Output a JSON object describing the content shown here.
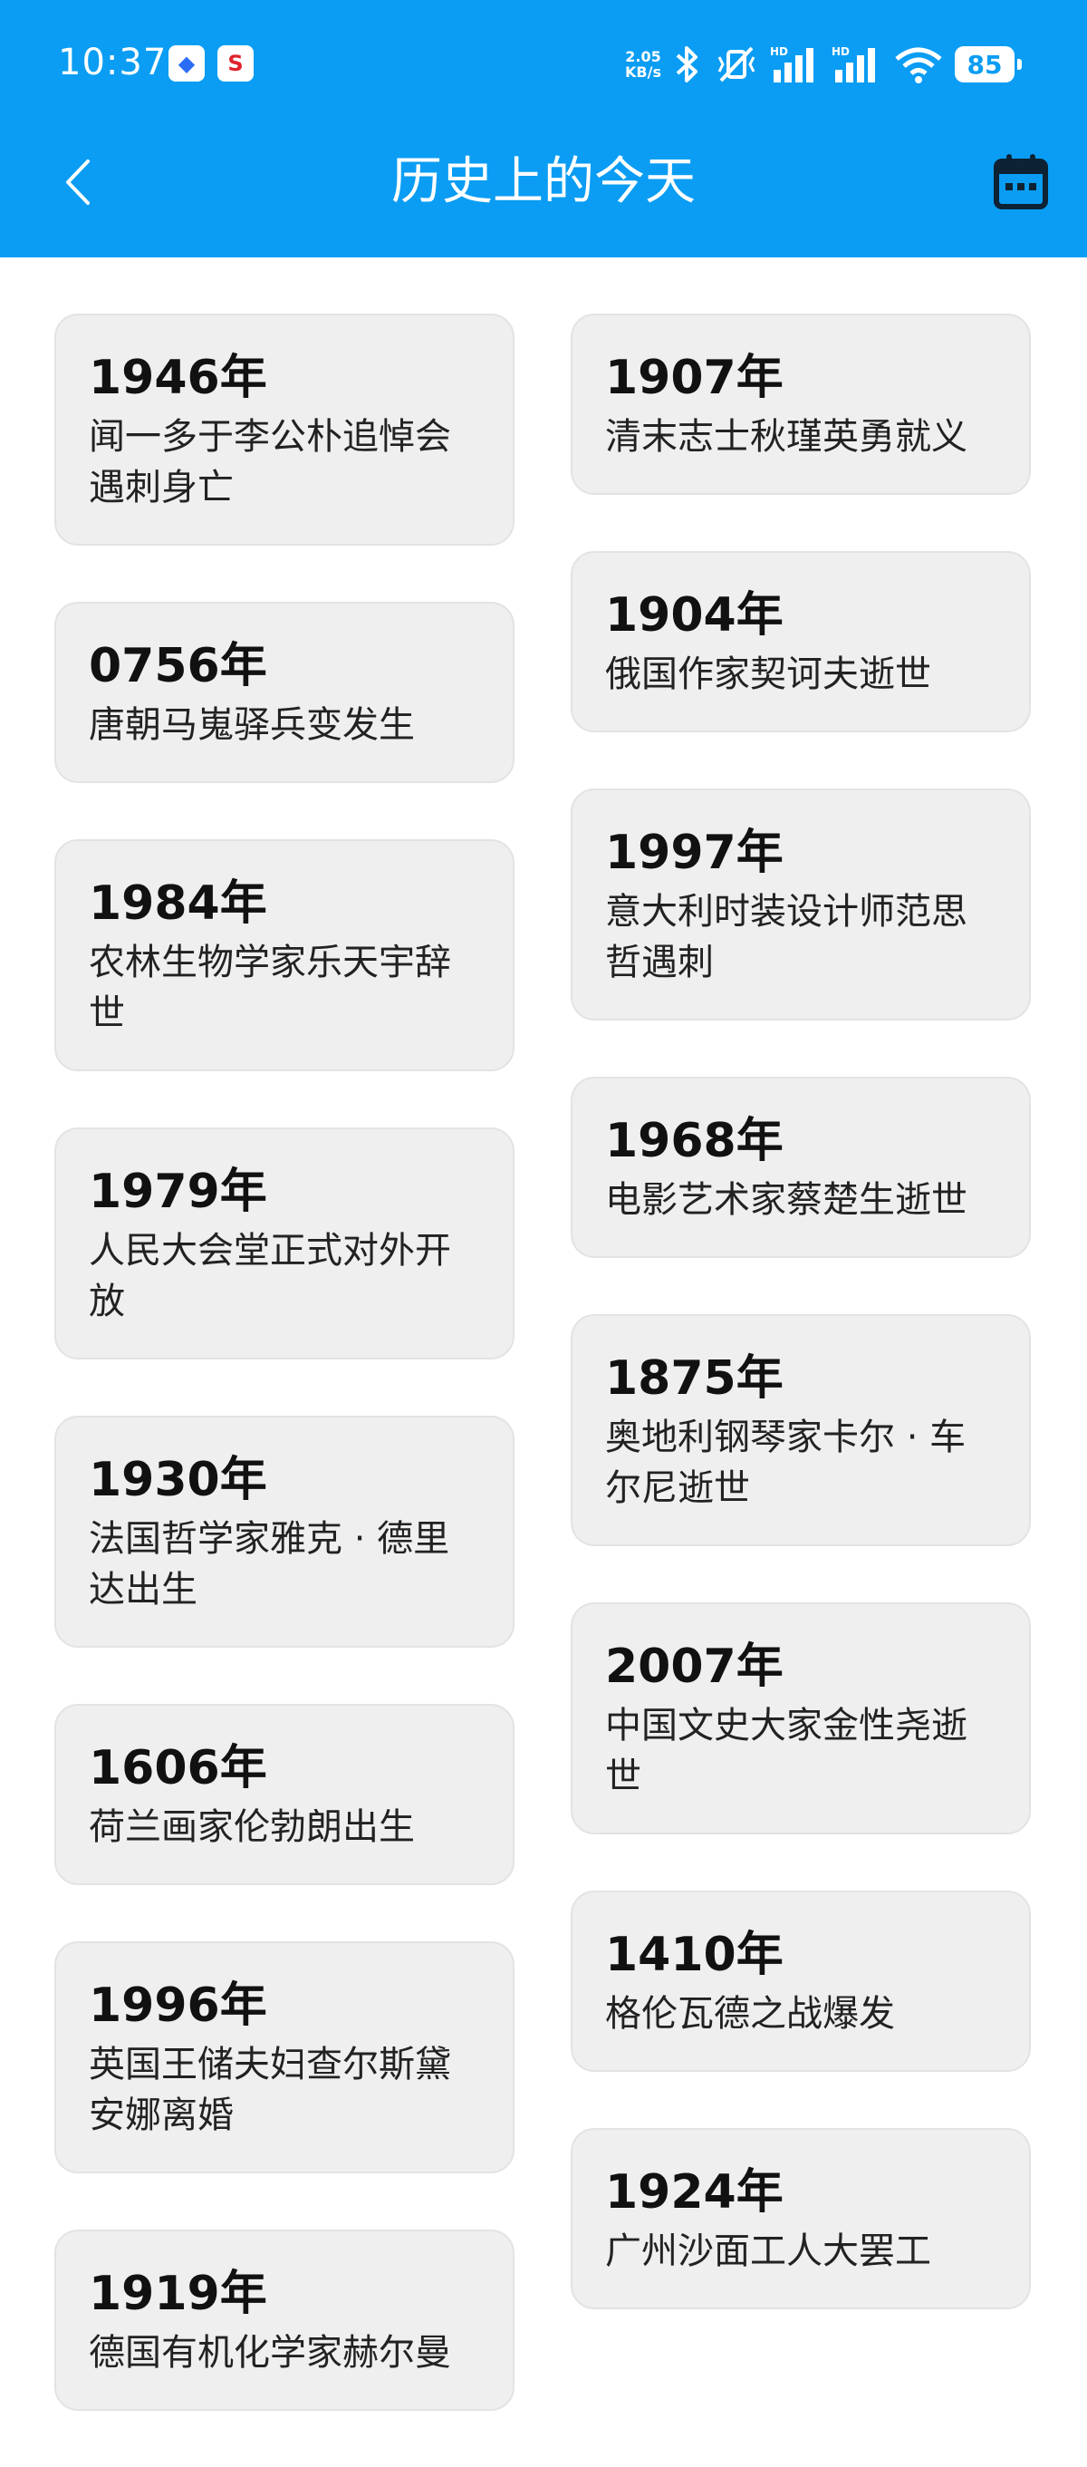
{
  "status_bar": {
    "time": "10:37",
    "net_speed_value": "2.05",
    "net_speed_unit": "KB/s",
    "battery": "85"
  },
  "header": {
    "title": "历史上的今天"
  },
  "events_left": [
    {
      "year": "1946年",
      "event": "闻一多于李公朴追悼会遇刺身亡"
    },
    {
      "year": "0756年",
      "event": "唐朝马嵬驿兵变发生"
    },
    {
      "year": "1984年",
      "event": "农林生物学家乐天宇辞世"
    },
    {
      "year": "1979年",
      "event": "人民大会堂正式对外开放"
    },
    {
      "year": "1930年",
      "event": "法国哲学家雅克 · 德里达出生"
    },
    {
      "year": "1606年",
      "event": "荷兰画家伦勃朗出生"
    },
    {
      "year": "1996年",
      "event": "英国王储夫妇查尔斯黛安娜离婚"
    },
    {
      "year": "1919年",
      "event": "德国有机化学家赫尔曼"
    }
  ],
  "events_right": [
    {
      "year": "1907年",
      "event": "清末志士秋瑾英勇就义"
    },
    {
      "year": "1904年",
      "event": "俄国作家契诃夫逝世"
    },
    {
      "year": "1997年",
      "event": "意大利时装设计师范思哲遇刺"
    },
    {
      "year": "1968年",
      "event": "电影艺术家蔡楚生逝世"
    },
    {
      "year": "1875年",
      "event": "奥地利钢琴家卡尔 · 车尔尼逝世"
    },
    {
      "year": "2007年",
      "event": "中国文史大家金性尧逝世"
    },
    {
      "year": "1410年",
      "event": "格伦瓦德之战爆发"
    },
    {
      "year": "1924年",
      "event": "广州沙面工人大罢工"
    }
  ],
  "colors": {
    "header_bg": "#0a9df3",
    "card_bg": "#efefef"
  }
}
